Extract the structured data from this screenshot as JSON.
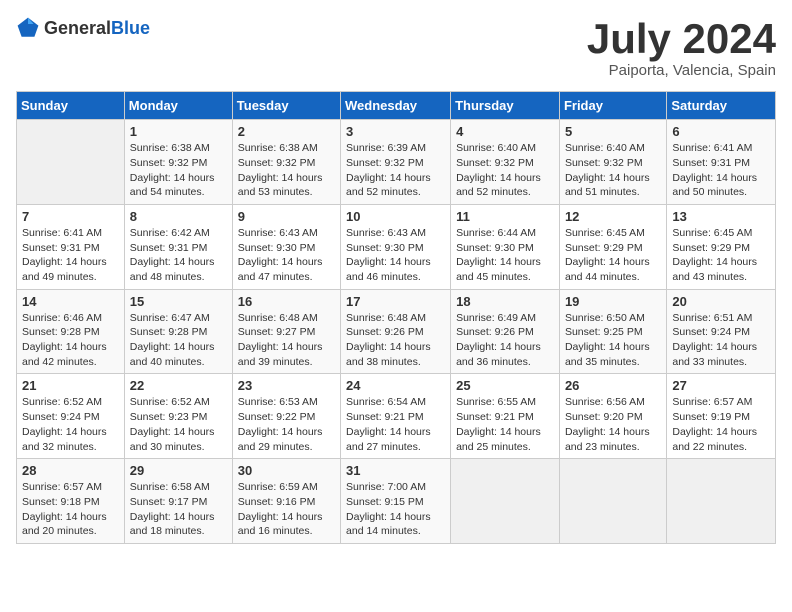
{
  "header": {
    "logo_general": "General",
    "logo_blue": "Blue",
    "month_year": "July 2024",
    "location": "Paiporta, Valencia, Spain"
  },
  "days_of_week": [
    "Sunday",
    "Monday",
    "Tuesday",
    "Wednesday",
    "Thursday",
    "Friday",
    "Saturday"
  ],
  "weeks": [
    [
      {
        "day": "",
        "empty": true
      },
      {
        "day": "1",
        "sunrise": "Sunrise: 6:38 AM",
        "sunset": "Sunset: 9:32 PM",
        "daylight": "Daylight: 14 hours and 54 minutes."
      },
      {
        "day": "2",
        "sunrise": "Sunrise: 6:38 AM",
        "sunset": "Sunset: 9:32 PM",
        "daylight": "Daylight: 14 hours and 53 minutes."
      },
      {
        "day": "3",
        "sunrise": "Sunrise: 6:39 AM",
        "sunset": "Sunset: 9:32 PM",
        "daylight": "Daylight: 14 hours and 52 minutes."
      },
      {
        "day": "4",
        "sunrise": "Sunrise: 6:40 AM",
        "sunset": "Sunset: 9:32 PM",
        "daylight": "Daylight: 14 hours and 52 minutes."
      },
      {
        "day": "5",
        "sunrise": "Sunrise: 6:40 AM",
        "sunset": "Sunset: 9:32 PM",
        "daylight": "Daylight: 14 hours and 51 minutes."
      },
      {
        "day": "6",
        "sunrise": "Sunrise: 6:41 AM",
        "sunset": "Sunset: 9:31 PM",
        "daylight": "Daylight: 14 hours and 50 minutes."
      }
    ],
    [
      {
        "day": "7",
        "sunrise": "Sunrise: 6:41 AM",
        "sunset": "Sunset: 9:31 PM",
        "daylight": "Daylight: 14 hours and 49 minutes."
      },
      {
        "day": "8",
        "sunrise": "Sunrise: 6:42 AM",
        "sunset": "Sunset: 9:31 PM",
        "daylight": "Daylight: 14 hours and 48 minutes."
      },
      {
        "day": "9",
        "sunrise": "Sunrise: 6:43 AM",
        "sunset": "Sunset: 9:30 PM",
        "daylight": "Daylight: 14 hours and 47 minutes."
      },
      {
        "day": "10",
        "sunrise": "Sunrise: 6:43 AM",
        "sunset": "Sunset: 9:30 PM",
        "daylight": "Daylight: 14 hours and 46 minutes."
      },
      {
        "day": "11",
        "sunrise": "Sunrise: 6:44 AM",
        "sunset": "Sunset: 9:30 PM",
        "daylight": "Daylight: 14 hours and 45 minutes."
      },
      {
        "day": "12",
        "sunrise": "Sunrise: 6:45 AM",
        "sunset": "Sunset: 9:29 PM",
        "daylight": "Daylight: 14 hours and 44 minutes."
      },
      {
        "day": "13",
        "sunrise": "Sunrise: 6:45 AM",
        "sunset": "Sunset: 9:29 PM",
        "daylight": "Daylight: 14 hours and 43 minutes."
      }
    ],
    [
      {
        "day": "14",
        "sunrise": "Sunrise: 6:46 AM",
        "sunset": "Sunset: 9:28 PM",
        "daylight": "Daylight: 14 hours and 42 minutes."
      },
      {
        "day": "15",
        "sunrise": "Sunrise: 6:47 AM",
        "sunset": "Sunset: 9:28 PM",
        "daylight": "Daylight: 14 hours and 40 minutes."
      },
      {
        "day": "16",
        "sunrise": "Sunrise: 6:48 AM",
        "sunset": "Sunset: 9:27 PM",
        "daylight": "Daylight: 14 hours and 39 minutes."
      },
      {
        "day": "17",
        "sunrise": "Sunrise: 6:48 AM",
        "sunset": "Sunset: 9:26 PM",
        "daylight": "Daylight: 14 hours and 38 minutes."
      },
      {
        "day": "18",
        "sunrise": "Sunrise: 6:49 AM",
        "sunset": "Sunset: 9:26 PM",
        "daylight": "Daylight: 14 hours and 36 minutes."
      },
      {
        "day": "19",
        "sunrise": "Sunrise: 6:50 AM",
        "sunset": "Sunset: 9:25 PM",
        "daylight": "Daylight: 14 hours and 35 minutes."
      },
      {
        "day": "20",
        "sunrise": "Sunrise: 6:51 AM",
        "sunset": "Sunset: 9:24 PM",
        "daylight": "Daylight: 14 hours and 33 minutes."
      }
    ],
    [
      {
        "day": "21",
        "sunrise": "Sunrise: 6:52 AM",
        "sunset": "Sunset: 9:24 PM",
        "daylight": "Daylight: 14 hours and 32 minutes."
      },
      {
        "day": "22",
        "sunrise": "Sunrise: 6:52 AM",
        "sunset": "Sunset: 9:23 PM",
        "daylight": "Daylight: 14 hours and 30 minutes."
      },
      {
        "day": "23",
        "sunrise": "Sunrise: 6:53 AM",
        "sunset": "Sunset: 9:22 PM",
        "daylight": "Daylight: 14 hours and 29 minutes."
      },
      {
        "day": "24",
        "sunrise": "Sunrise: 6:54 AM",
        "sunset": "Sunset: 9:21 PM",
        "daylight": "Daylight: 14 hours and 27 minutes."
      },
      {
        "day": "25",
        "sunrise": "Sunrise: 6:55 AM",
        "sunset": "Sunset: 9:21 PM",
        "daylight": "Daylight: 14 hours and 25 minutes."
      },
      {
        "day": "26",
        "sunrise": "Sunrise: 6:56 AM",
        "sunset": "Sunset: 9:20 PM",
        "daylight": "Daylight: 14 hours and 23 minutes."
      },
      {
        "day": "27",
        "sunrise": "Sunrise: 6:57 AM",
        "sunset": "Sunset: 9:19 PM",
        "daylight": "Daylight: 14 hours and 22 minutes."
      }
    ],
    [
      {
        "day": "28",
        "sunrise": "Sunrise: 6:57 AM",
        "sunset": "Sunset: 9:18 PM",
        "daylight": "Daylight: 14 hours and 20 minutes."
      },
      {
        "day": "29",
        "sunrise": "Sunrise: 6:58 AM",
        "sunset": "Sunset: 9:17 PM",
        "daylight": "Daylight: 14 hours and 18 minutes."
      },
      {
        "day": "30",
        "sunrise": "Sunrise: 6:59 AM",
        "sunset": "Sunset: 9:16 PM",
        "daylight": "Daylight: 14 hours and 16 minutes."
      },
      {
        "day": "31",
        "sunrise": "Sunrise: 7:00 AM",
        "sunset": "Sunset: 9:15 PM",
        "daylight": "Daylight: 14 hours and 14 minutes."
      },
      {
        "day": "",
        "empty": true
      },
      {
        "day": "",
        "empty": true
      },
      {
        "day": "",
        "empty": true
      }
    ]
  ]
}
